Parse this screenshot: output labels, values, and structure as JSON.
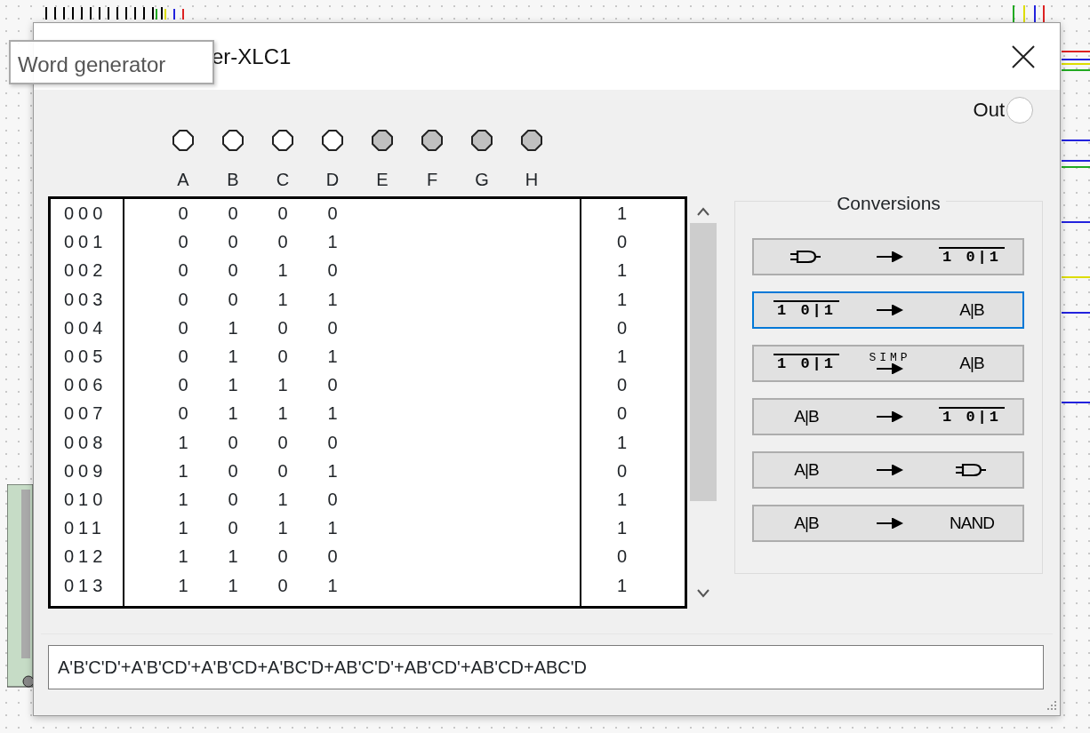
{
  "window": {
    "title": "er-XLC1"
  },
  "tooltip": {
    "text": "Word generator"
  },
  "output_probe": {
    "label": "Out"
  },
  "inputs": [
    {
      "label": "A",
      "active": true
    },
    {
      "label": "B",
      "active": true
    },
    {
      "label": "C",
      "active": true
    },
    {
      "label": "D",
      "active": true
    },
    {
      "label": "E",
      "active": false
    },
    {
      "label": "F",
      "active": false
    },
    {
      "label": "G",
      "active": false
    },
    {
      "label": "H",
      "active": false
    }
  ],
  "truth_table": {
    "rows": [
      {
        "index": "000",
        "inputs": [
          "0",
          "0",
          "0",
          "0"
        ],
        "output": "1"
      },
      {
        "index": "001",
        "inputs": [
          "0",
          "0",
          "0",
          "1"
        ],
        "output": "0"
      },
      {
        "index": "002",
        "inputs": [
          "0",
          "0",
          "1",
          "0"
        ],
        "output": "1"
      },
      {
        "index": "003",
        "inputs": [
          "0",
          "0",
          "1",
          "1"
        ],
        "output": "1"
      },
      {
        "index": "004",
        "inputs": [
          "0",
          "1",
          "0",
          "0"
        ],
        "output": "0"
      },
      {
        "index": "005",
        "inputs": [
          "0",
          "1",
          "0",
          "1"
        ],
        "output": "1"
      },
      {
        "index": "006",
        "inputs": [
          "0",
          "1",
          "1",
          "0"
        ],
        "output": "0"
      },
      {
        "index": "007",
        "inputs": [
          "0",
          "1",
          "1",
          "1"
        ],
        "output": "0"
      },
      {
        "index": "008",
        "inputs": [
          "1",
          "0",
          "0",
          "0"
        ],
        "output": "1"
      },
      {
        "index": "009",
        "inputs": [
          "1",
          "0",
          "0",
          "1"
        ],
        "output": "0"
      },
      {
        "index": "010",
        "inputs": [
          "1",
          "0",
          "1",
          "0"
        ],
        "output": "1"
      },
      {
        "index": "011",
        "inputs": [
          "1",
          "0",
          "1",
          "1"
        ],
        "output": "1"
      },
      {
        "index": "012",
        "inputs": [
          "1",
          "1",
          "0",
          "0"
        ],
        "output": "0"
      },
      {
        "index": "013",
        "inputs": [
          "1",
          "1",
          "0",
          "1"
        ],
        "output": "1"
      }
    ]
  },
  "conversions": {
    "title": "Conversions",
    "buttons": [
      {
        "selected": false,
        "parts": [
          {
            "kind": "gate"
          },
          {
            "kind": "arrow"
          },
          {
            "kind": "table",
            "text": "1 0|1"
          }
        ]
      },
      {
        "selected": true,
        "parts": [
          {
            "kind": "table",
            "text": "1 0|1"
          },
          {
            "kind": "arrow"
          },
          {
            "kind": "text",
            "text": "A|B"
          }
        ]
      },
      {
        "selected": false,
        "parts": [
          {
            "kind": "table",
            "text": "1 0|1"
          },
          {
            "kind": "simp",
            "text": "SIMP"
          },
          {
            "kind": "text",
            "text": "A|B"
          }
        ]
      },
      {
        "selected": false,
        "parts": [
          {
            "kind": "text",
            "text": "A|B"
          },
          {
            "kind": "arrow"
          },
          {
            "kind": "table",
            "text": "1 0|1"
          }
        ]
      },
      {
        "selected": false,
        "parts": [
          {
            "kind": "text",
            "text": "A|B"
          },
          {
            "kind": "arrow"
          },
          {
            "kind": "gate"
          }
        ]
      },
      {
        "selected": false,
        "parts": [
          {
            "kind": "text",
            "text": "A|B"
          },
          {
            "kind": "arrow"
          },
          {
            "kind": "text",
            "text": "NAND"
          }
        ]
      }
    ]
  },
  "expression": {
    "value": "A'B'C'D'+A'B'CD'+A'B'CD+A'BC'D+AB'C'D'+AB'CD'+AB'CD+ABC'D"
  }
}
